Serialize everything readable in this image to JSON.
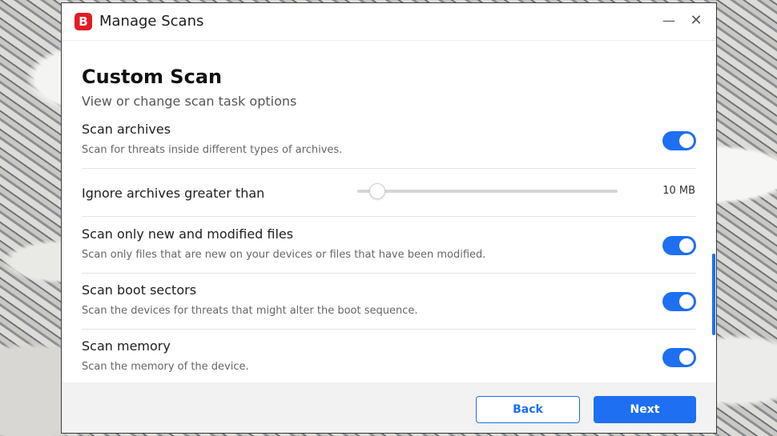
{
  "window": {
    "logo_letter": "B",
    "title": "Manage Scans",
    "minimize_glyph": "—",
    "close_glyph": "✕"
  },
  "page": {
    "title": "Custom Scan",
    "subtitle": "View or change scan task options"
  },
  "options": [
    {
      "label": "Scan archives",
      "description": "Scan for threats inside different types of archives.",
      "enabled": true
    },
    {
      "label": "Ignore archives greater than",
      "value": "10 MB",
      "slider_fraction": 0.0
    },
    {
      "label": "Scan only new and modified files",
      "description": "Scan only files that are new on your devices or files that have been modified.",
      "enabled": true
    },
    {
      "label": "Scan boot sectors",
      "description": "Scan the devices for threats that might alter the boot sequence.",
      "enabled": true
    },
    {
      "label": "Scan memory",
      "description": "Scan the memory of the device.",
      "enabled": true
    }
  ],
  "footer": {
    "back_label": "Back",
    "next_label": "Next"
  },
  "colors": {
    "accent": "#1e6ff1",
    "brand": "#e41b23"
  }
}
